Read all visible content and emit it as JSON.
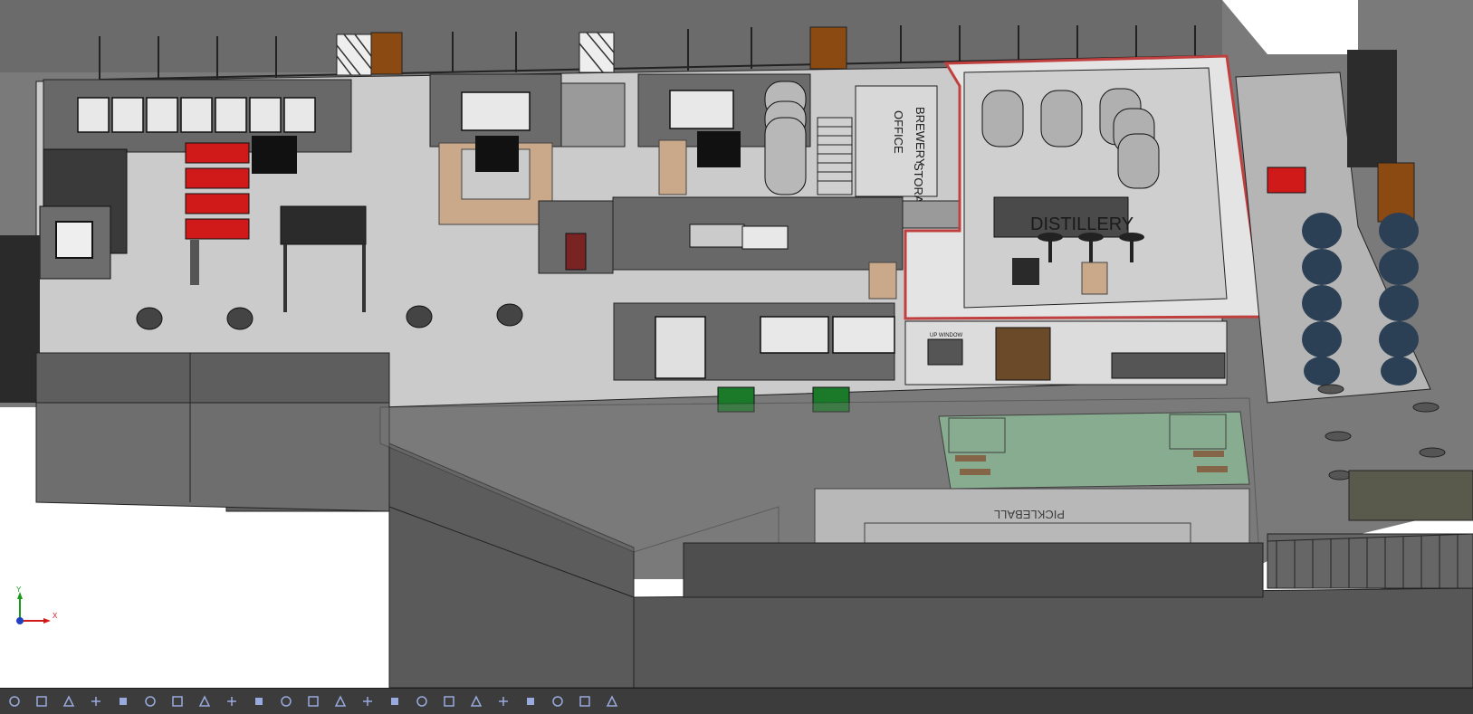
{
  "viewport": {
    "labels": {
      "brewery": "BREWERY",
      "office": "OFFICE",
      "storage": "STORAGE",
      "distillery": "DISTILLERY",
      "pickleball": "PICKLEBALL",
      "window_sign": "UP WINDOW"
    },
    "triad": {
      "y": "Y",
      "x": "X"
    }
  },
  "colors": {
    "wall_dark": "#5f5f5f",
    "wall_mid": "#8a8a8a",
    "floor": "#c8c8c8",
    "court": "#8fc79a",
    "accent_red": "#d01919",
    "wood": "#8b5a2b"
  },
  "toolbar": {
    "icons": [
      "rotate-view-icon",
      "zoom-fit-icon",
      "zoom-area-icon",
      "previous-view-icon",
      "section-view-icon",
      "view-orientation-icon",
      "display-style-icon",
      "hide-show-icon",
      "edit-appearance-icon",
      "apply-scene-icon",
      "view-settings-icon",
      "realview-icon",
      "shadows-icon",
      "ambient-occlusion-icon",
      "perspective-icon",
      "cartoon-icon",
      "camera-icon",
      "lights-icon",
      "measure-icon",
      "mass-properties-icon",
      "section-properties-icon",
      "interference-icon",
      "snapshot-icon"
    ]
  }
}
